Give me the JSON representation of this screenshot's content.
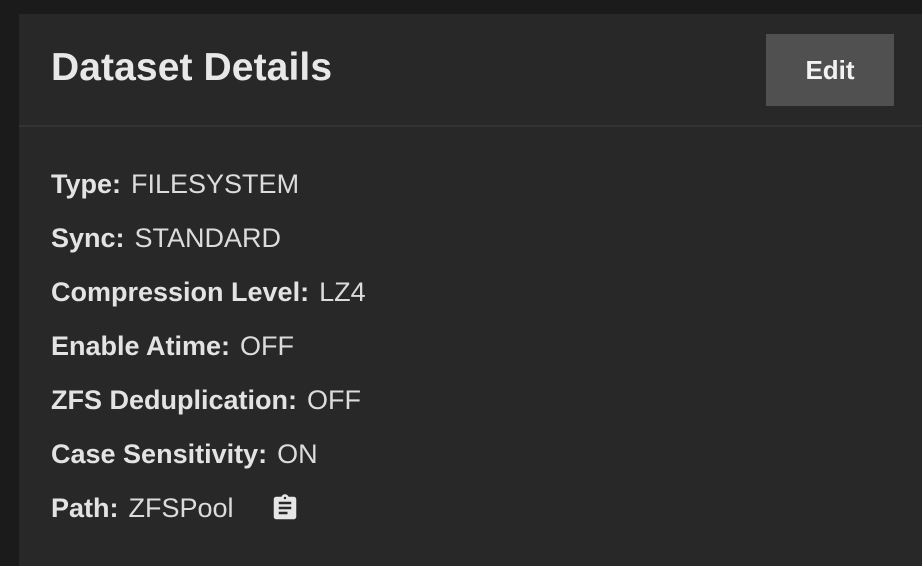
{
  "card": {
    "title": "Dataset Details",
    "edit_label": "Edit"
  },
  "details": [
    {
      "label": "Type:",
      "value": "FILESYSTEM"
    },
    {
      "label": "Sync:",
      "value": "STANDARD"
    },
    {
      "label": "Compression Level:",
      "value": "LZ4"
    },
    {
      "label": "Enable Atime:",
      "value": "OFF"
    },
    {
      "label": "ZFS Deduplication:",
      "value": "OFF"
    },
    {
      "label": "Case Sensitivity:",
      "value": "ON"
    },
    {
      "label": "Path:",
      "value": "ZFSPool",
      "icon": "clipboard-icon"
    }
  ]
}
